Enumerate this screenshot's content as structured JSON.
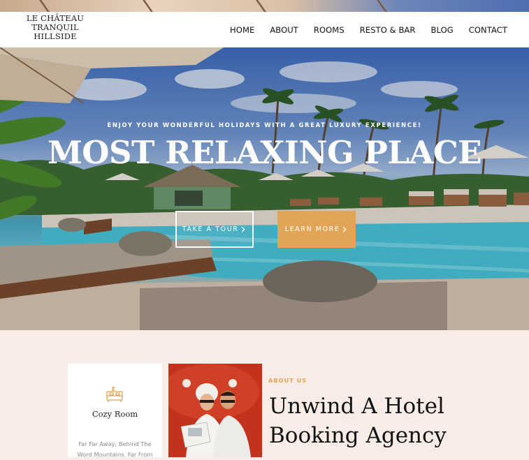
{
  "logo": {
    "line1": "LE CHÂTEAU",
    "line2": "TRANQUIL",
    "line3": "HILLSIDE"
  },
  "nav": {
    "items": [
      {
        "label": "HOME"
      },
      {
        "label": "ABOUT"
      },
      {
        "label": "ROOMS"
      },
      {
        "label": "RESTO & BAR"
      },
      {
        "label": "BLOG"
      },
      {
        "label": "CONTACT"
      }
    ]
  },
  "hero": {
    "subtitle": "ENJOY YOUR WONDERFUL HOLIDAYS WITH A GREAT LUXURY EXPERIENCE!",
    "title": "MOST RELAXING PLACE",
    "buttons": {
      "tour_label": "TAKE A TOUR",
      "more_label": "LEARN MORE"
    }
  },
  "about": {
    "room_card": {
      "icon": "bed-icon",
      "title": "Cozy Room",
      "description": "Far Far Away, Behind The Word Mountains, Far From"
    },
    "eyebrow": "ABOUT US",
    "heading_line1": "Unwind A Hotel",
    "heading_line2": "Booking Agency"
  },
  "colors": {
    "accent": "#e2a557",
    "header_bg": "#ffffff",
    "section_bg": "#f7ece6",
    "text_dark": "#111111"
  }
}
